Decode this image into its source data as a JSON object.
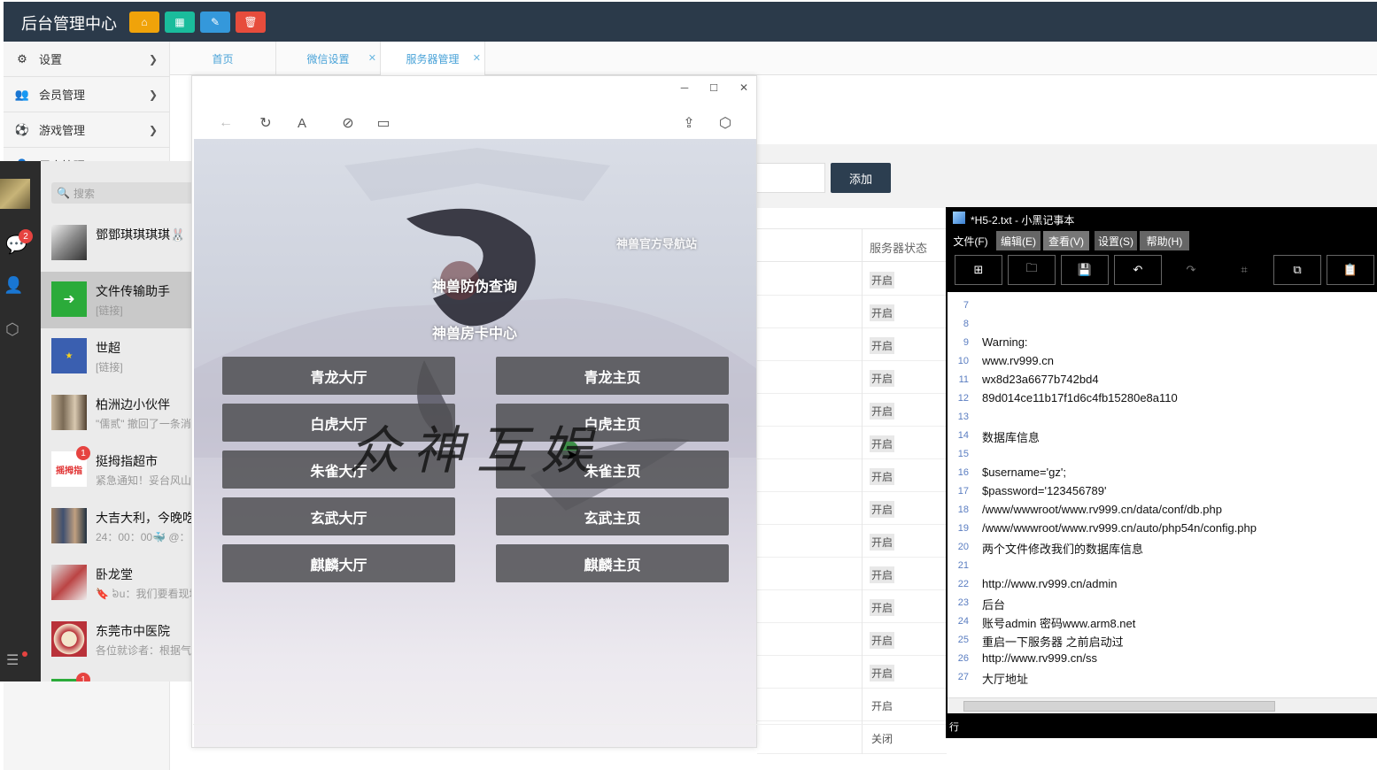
{
  "admin": {
    "title": "后台管理中心",
    "header_buttons": [
      {
        "icon": "home-icon",
        "color": "#f0a30a"
      },
      {
        "icon": "grid-icon",
        "color": "#1abc9c"
      },
      {
        "icon": "pencil-icon",
        "color": "#3498db"
      },
      {
        "icon": "trash-icon",
        "color": "#e74c3c"
      }
    ],
    "sidebar": [
      {
        "label": "设置",
        "icon": "gears-icon"
      },
      {
        "label": "会员管理",
        "icon": "users-icon"
      },
      {
        "label": "游戏管理",
        "icon": "football-icon"
      },
      {
        "label": "用户管理",
        "icon": "user-icon"
      }
    ],
    "tabs": [
      "首页",
      "微信设置",
      "服务器管理"
    ],
    "add_button": "添加",
    "table": {
      "header": "服务器状态",
      "statuses": [
        "开启",
        "开启",
        "开启",
        "开启",
        "开启",
        "开启",
        "开启",
        "开启",
        "开启",
        "开启",
        "开启",
        "开启",
        "开启",
        "开启",
        "关闭"
      ]
    }
  },
  "wechat": {
    "search_placeholder": "搜索",
    "unread_top": "2",
    "chats": [
      {
        "name": "鄧鄧琪琪琪琪🐰",
        "preview": ""
      },
      {
        "name": "文件传输助手",
        "preview": "[链接]"
      },
      {
        "name": "世超",
        "preview": "[链接]"
      },
      {
        "name": "柏洲边小伙伴",
        "preview": "\"儒贰\" 撤回了一条消息"
      },
      {
        "name": "挺拇指超市",
        "preview": "紧急通知！妥台风山竹",
        "badge": "1"
      },
      {
        "name": "大吉大利，今晚吃鸡",
        "preview": "24：00：00🐳 @："
      },
      {
        "name": "卧龙堂",
        "preview": "🔖 ៦u：我们要看现场"
      },
      {
        "name": "东莞市中医院",
        "preview": "各位就诊者：根据气象"
      }
    ],
    "bottom_badge": "1"
  },
  "browser": {
    "nav_title": "神兽官方导航站",
    "links": [
      "神兽防伪查询",
      "神兽房卡中心"
    ],
    "watermark": "众神互娱",
    "buttons": [
      [
        "青龙大厅",
        "青龙主页"
      ],
      [
        "白虎大厅",
        "白虎主页"
      ],
      [
        "朱雀大厅",
        "朱雀主页"
      ],
      [
        "玄武大厅",
        "玄武主页"
      ],
      [
        "麒麟大厅",
        "麒麟主页"
      ]
    ]
  },
  "notepad": {
    "title": "*H5-2.txt - 小黑记事本",
    "menus": [
      "文件(F)",
      "编辑(E)",
      "查看(V)",
      "设置(S)",
      "帮助(H)"
    ],
    "lines": [
      {
        "n": "7",
        "t": ""
      },
      {
        "n": "8",
        "t": ""
      },
      {
        "n": "9",
        "t": "Warning:"
      },
      {
        "n": "10",
        "t": "www.rv999.cn"
      },
      {
        "n": "11",
        "t": "wx8d23a6677b742bd4"
      },
      {
        "n": "12",
        "t": "89d014ce11b17f1d6c4fb15280e8a110"
      },
      {
        "n": "13",
        "t": ""
      },
      {
        "n": "14",
        "t": "数据库信息"
      },
      {
        "n": "15",
        "t": ""
      },
      {
        "n": "16",
        "t": "$username='gz';"
      },
      {
        "n": "17",
        "t": "$password='123456789'"
      },
      {
        "n": "18",
        "t": "/www/wwwroot/www.rv999.cn/data/conf/db.php"
      },
      {
        "n": "19",
        "t": "/www/wwwroot/www.rv999.cn/auto/php54n/config.php"
      },
      {
        "n": "20",
        "t": "两个文件修改我们的数据库信息"
      },
      {
        "n": "21",
        "t": ""
      },
      {
        "n": "22",
        "t": "http://www.rv999.cn/admin"
      },
      {
        "n": "23",
        "t": "后台"
      },
      {
        "n": "24",
        "t": "账号admin 密码www.arm8.net"
      },
      {
        "n": "25",
        "t": "重启一下服务器 之前启动过"
      },
      {
        "n": "26",
        "t": "http://www.rv999.cn/ss"
      },
      {
        "n": "27",
        "t": "大厅地址"
      }
    ],
    "status_prefix": "行"
  }
}
